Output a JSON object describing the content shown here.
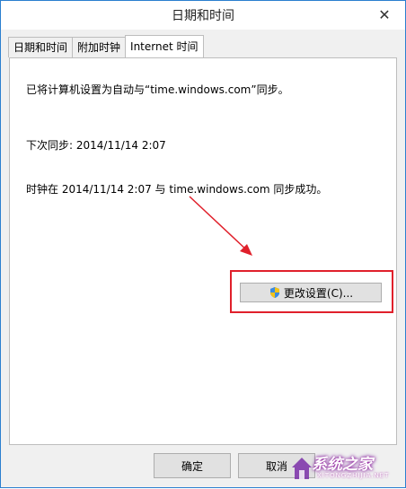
{
  "window": {
    "title": "日期和时间",
    "close_icon": "close-icon"
  },
  "tabs": [
    {
      "label": "日期和时间"
    },
    {
      "label": "附加时钟"
    },
    {
      "label": "Internet 时间"
    }
  ],
  "panel": {
    "sync_info": "已将计算机设置为自动与“time.windows.com”同步。",
    "next_sync": "下次同步: 2014/11/14 2:07",
    "last_sync": "时钟在 2014/11/14 2:07 与 time.windows.com 同步成功。",
    "change_settings_label": "更改设置(C)...",
    "change_settings_icon": "uac-shield-icon"
  },
  "annotation": {
    "color": "#e0202b"
  },
  "footer": {
    "ok_label": "确定",
    "cancel_label": "取消"
  },
  "watermark": {
    "text": "系统之家",
    "sub": "XITONGZHIJIA.NET"
  }
}
